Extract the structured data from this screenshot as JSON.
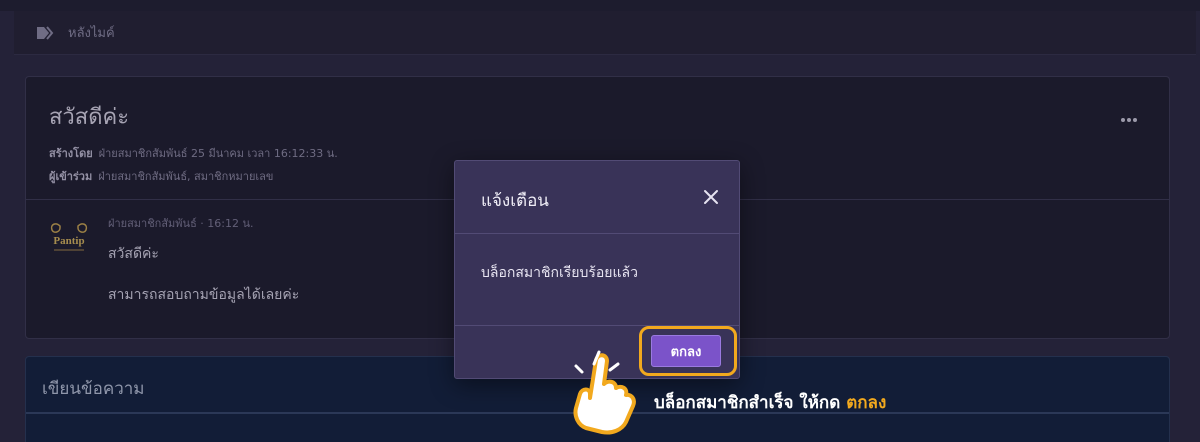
{
  "breadcrumb": {
    "icon": "forward-tag-icon",
    "label": "หลังไมค์"
  },
  "topic": {
    "title": "สวัสดีค่ะ",
    "created_by_label": "สร้างโดย",
    "created_by_value": "ฝ่ายสมาชิกสัมพันธ์ 25 มีนาคม เวลา 16:12:33 น.",
    "participants_label": "ผู้เข้าร่วม",
    "participants_value": "ฝ่ายสมาชิกสัมพันธ์, สมาชิกหมายเลข",
    "more_icon": "ellipsis-icon",
    "message": {
      "avatar_text": "Pantip",
      "meta": "ฝ่ายสมาชิกสัมพันธ์ · 16:12 น.",
      "line1": "สวัสดีค่ะ",
      "line2": "สามารถสอบถามข้อมูลได้เลยค่ะ"
    }
  },
  "reply": {
    "title": "เขียนข้อความ"
  },
  "modal": {
    "title": "แจ้งเตือน",
    "close_icon": "close-icon",
    "body": "บล็อกสมาชิกเรียบร้อยแล้ว",
    "ok_label": "ตกลง"
  },
  "annotation": {
    "text": "บล็อกสมาชิกสำเร็จ ให้กด",
    "accent": "ตกลง",
    "pointer_icon": "hand-pointer-icon"
  },
  "colors": {
    "background": "#2a2741",
    "modal": "#393358",
    "button": "#7b53c9",
    "highlight": "#f2a91e"
  }
}
